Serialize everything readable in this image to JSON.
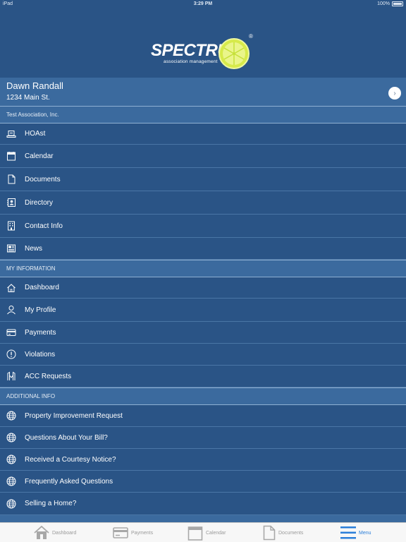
{
  "status_bar": {
    "device": "iPad",
    "time": "3:29 PM",
    "battery": "100%"
  },
  "logo": {
    "brand": "SPECTRUM",
    "tagline": "association management",
    "registered": "®"
  },
  "user": {
    "name": "Dawn Randall",
    "address": "1234 Main St."
  },
  "association": {
    "name": "Test Association, Inc."
  },
  "association_menu": [
    {
      "label": "HOAst",
      "icon": "laptop-icon"
    },
    {
      "label": "Calendar",
      "icon": "calendar-icon"
    },
    {
      "label": "Documents",
      "icon": "document-icon"
    },
    {
      "label": "Directory",
      "icon": "directory-icon"
    },
    {
      "label": "Contact Info",
      "icon": "building-icon"
    },
    {
      "label": "News",
      "icon": "newspaper-icon"
    }
  ],
  "my_information": {
    "header": "MY INFORMATION",
    "items": [
      {
        "label": "Dashboard",
        "icon": "home-icon"
      },
      {
        "label": "My Profile",
        "icon": "person-icon"
      },
      {
        "label": "Payments",
        "icon": "credit-card-icon"
      },
      {
        "label": "Violations",
        "icon": "alert-icon"
      },
      {
        "label": "ACC Requests",
        "icon": "acc-icon"
      }
    ]
  },
  "additional_info": {
    "header": "ADDITIONAL INFO",
    "items": [
      {
        "label": "Property Improvement Request",
        "icon": "globe-icon"
      },
      {
        "label": "Questions About Your Bill?",
        "icon": "globe-icon"
      },
      {
        "label": "Received a Courtesy Notice?",
        "icon": "globe-icon"
      },
      {
        "label": "Frequently Asked Questions",
        "icon": "globe-icon"
      },
      {
        "label": "Selling a Home?",
        "icon": "globe-icon"
      }
    ]
  },
  "tab_bar": {
    "tabs": [
      {
        "label": "Dashboard",
        "icon": "home-icon"
      },
      {
        "label": "Payments",
        "icon": "credit-card-icon"
      },
      {
        "label": "Calendar",
        "icon": "calendar-icon"
      },
      {
        "label": "Documents",
        "icon": "document-icon"
      },
      {
        "label": "Menu",
        "icon": "hamburger-icon",
        "active": true
      }
    ]
  },
  "colors": {
    "background": "#2a5486",
    "header": "#3b6a9e",
    "accent": "#2c7fd9",
    "lemon": "#c6e03a"
  }
}
